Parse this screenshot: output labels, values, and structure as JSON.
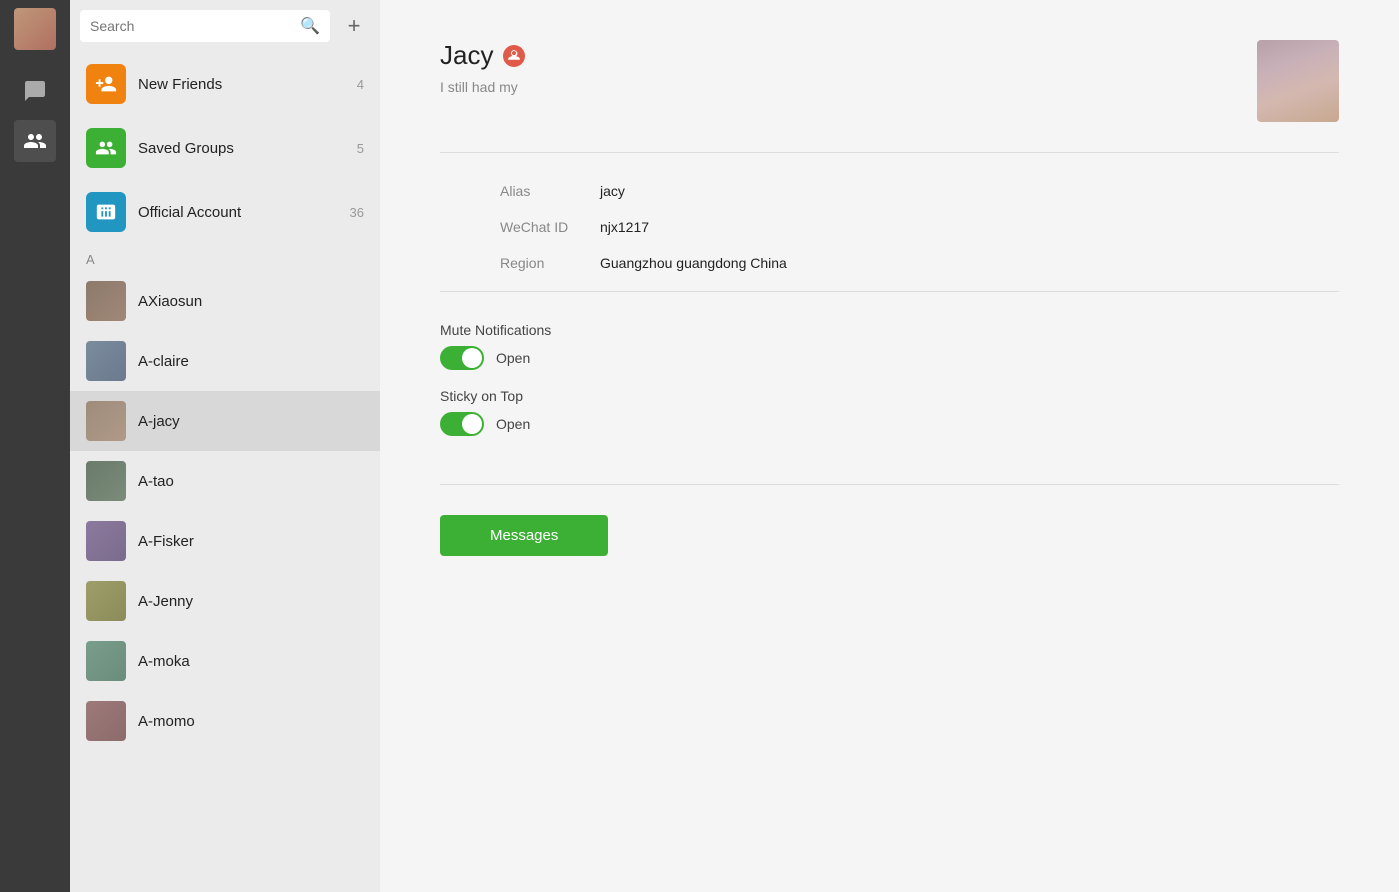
{
  "sidebar": {
    "icons": [
      {
        "name": "chat-icon",
        "label": "Chat",
        "active": false
      },
      {
        "name": "contacts-icon",
        "label": "Contacts",
        "active": true
      }
    ]
  },
  "search": {
    "placeholder": "Search",
    "value": ""
  },
  "add_button": "+",
  "special_items": [
    {
      "id": "new-friends",
      "label": "New Friends",
      "badge": "4",
      "icon_type": "orange"
    },
    {
      "id": "saved-groups",
      "label": "Saved Groups",
      "badge": "5",
      "icon_type": "green"
    },
    {
      "id": "official-account",
      "label": "Official Account",
      "badge": "36",
      "icon_type": "blue"
    }
  ],
  "section_label": "A",
  "contacts": [
    {
      "id": "axiaosun",
      "name": "AXiaosun",
      "avatar_class": "av1"
    },
    {
      "id": "a-claire",
      "name": "A-claire",
      "avatar_class": "av2"
    },
    {
      "id": "a-jacy",
      "name": "A-jacy",
      "avatar_class": "av3",
      "selected": true
    },
    {
      "id": "a-tao",
      "name": "A-tao",
      "avatar_class": "av4"
    },
    {
      "id": "a-fisker",
      "name": "A-Fisker",
      "avatar_class": "av5"
    },
    {
      "id": "a-jenny",
      "name": "A-Jenny",
      "avatar_class": "av6"
    },
    {
      "id": "a-moka",
      "name": "A-moka",
      "avatar_class": "av7"
    },
    {
      "id": "a-momo",
      "name": "A-momo",
      "avatar_class": "av8"
    }
  ],
  "profile": {
    "name": "Jacy",
    "status_message": "I still had my",
    "alias_label": "Alias",
    "alias_value": "jacy",
    "wechat_id_label": "WeChat ID",
    "wechat_id_value": "njx1217",
    "region_label": "Region",
    "region_value": "Guangzhou guangdong China",
    "mute_label": "Mute Notifications",
    "mute_toggle_text": "Open",
    "sticky_label": "Sticky on Top",
    "sticky_toggle_text": "Open",
    "messages_button": "Messages"
  }
}
